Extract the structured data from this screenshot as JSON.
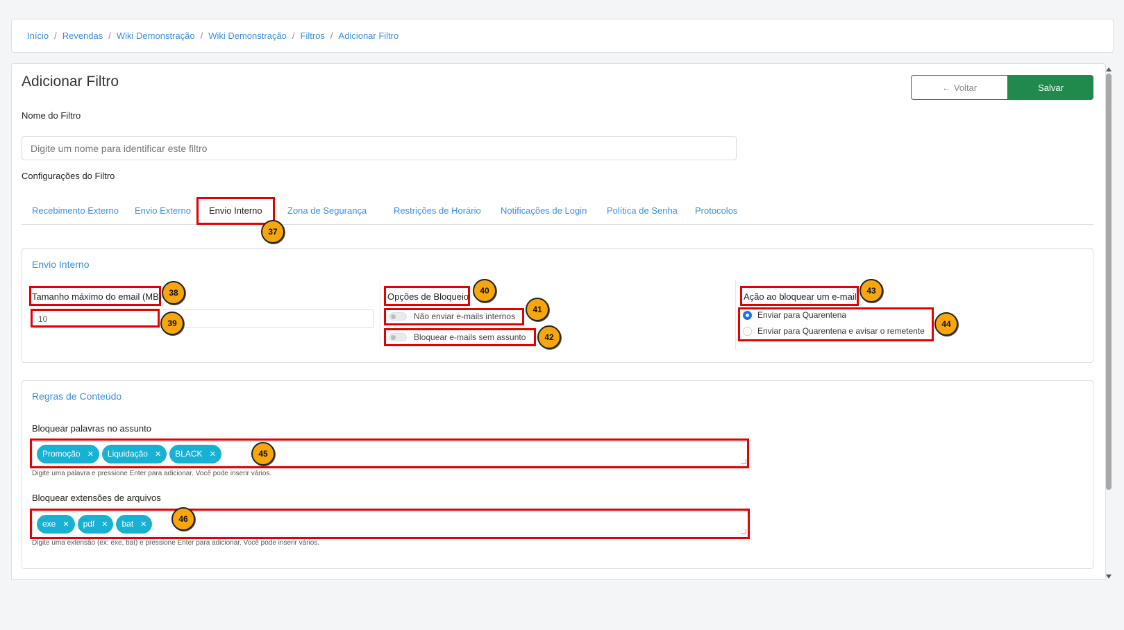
{
  "breadcrumb": [
    "Início",
    "Revendas",
    "Wiki Demonstração",
    "Wiki Demonstração",
    "Filtros",
    "Adicionar Filtro"
  ],
  "page": {
    "title": "Adicionar Filtro",
    "back_label": "Voltar",
    "save_label": "Salvar"
  },
  "name_field": {
    "label": "Nome do Filtro",
    "placeholder": "Digite um nome para identificar este filtro"
  },
  "config_label": "Configurações do Filtro",
  "tabs": [
    "Recebimento Externo",
    "Envio Externo",
    "Envio Interno",
    "Zona de Segurança",
    "Restrições de Horário",
    "Notificações de Login",
    "Política de Senha",
    "Protocolos"
  ],
  "active_tab": "Envio Interno",
  "envio_interno": {
    "title": "Envio Interno",
    "max_size_label": "Tamanho máximo do email (MB)",
    "max_size_value": "10",
    "block_options_label": "Opções de Bloqueio",
    "block_options": [
      {
        "label": "Não enviar e-mails internos",
        "on": false
      },
      {
        "label": "Bloquear e-mails sem assunto",
        "on": false
      }
    ],
    "action_label": "Ação ao bloquear um e-mail",
    "actions": [
      {
        "label": "Enviar para Quarentena",
        "checked": true
      },
      {
        "label": "Enviar para Quarentena e avisar o remetente",
        "checked": false
      }
    ]
  },
  "regras": {
    "title": "Regras de Conteúdo",
    "subject_label": "Bloquear palavras no assunto",
    "subject_tags": [
      "Promoção",
      "Liquidação",
      "BLACK"
    ],
    "subject_help": "Digite uma palavra e pressione Enter para adicionar. Você pode inserir vários.",
    "ext_label": "Bloquear extensões de arquivos",
    "ext_tags": [
      "exe",
      "pdf",
      "bat"
    ],
    "ext_help": "Digite uma extensão (ex: exe, bat) e pressione Enter para adicionar. Você pode inserir vários."
  },
  "annotations": [
    "37",
    "38",
    "39",
    "40",
    "41",
    "42",
    "43",
    "44",
    "45",
    "46"
  ],
  "colors": {
    "link": "#3a8ee6",
    "save": "#1f8a4c",
    "tag": "#17b1d3",
    "annotation_box": "#e30000",
    "annotation_badge": "#f7a70c"
  }
}
